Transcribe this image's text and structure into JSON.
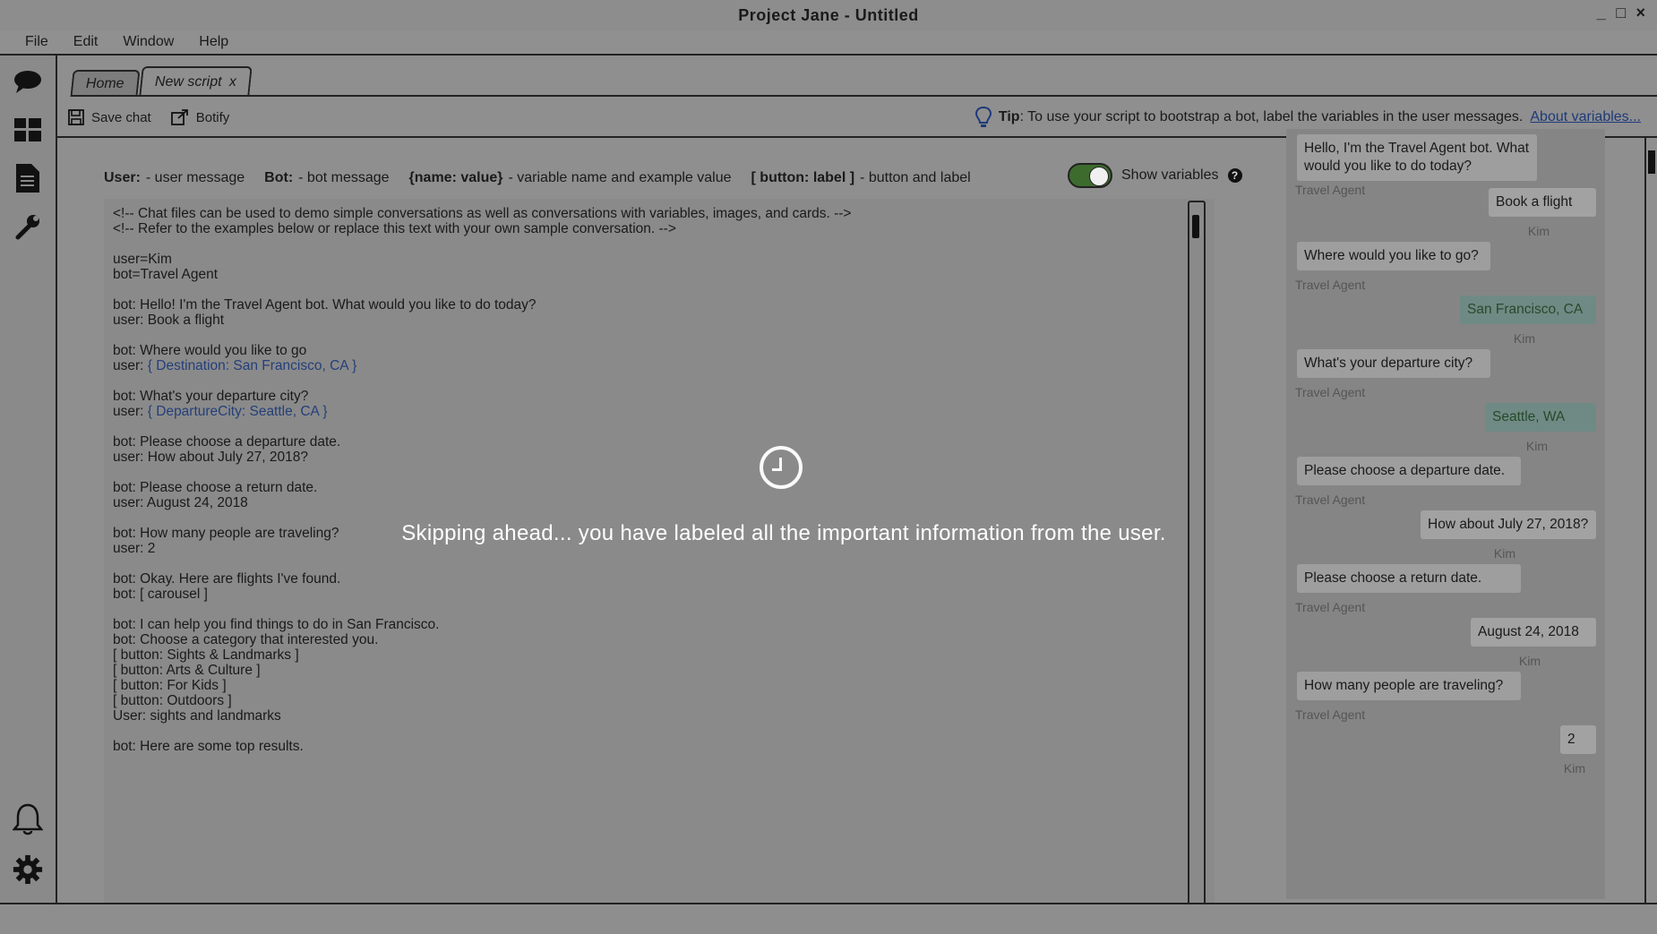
{
  "window": {
    "title": "Project Jane - Untitled",
    "controls": [
      "_",
      "□",
      "×"
    ]
  },
  "menu": [
    "File",
    "Edit",
    "Window",
    "Help"
  ],
  "tabs": [
    {
      "label": "Home"
    },
    {
      "label": "New script",
      "close": "x"
    }
  ],
  "toolbar": {
    "save_label": "Save chat",
    "botify_label": "Botify"
  },
  "tip": {
    "prefix": "Tip",
    "text": ": To use your script to bootstrap a bot, label the variables in the user messages.",
    "link": "About variables..."
  },
  "legend": {
    "user_key": "User:",
    "user_desc": "- user message",
    "bot_key": "Bot:",
    "bot_desc": "- bot message",
    "var_key": "{name: value}",
    "var_desc": "- variable name and example value",
    "btn_key": "[ button: label ]",
    "btn_desc": "- button and label"
  },
  "show_variables_label": "Show variables",
  "script": {
    "lines": [
      {
        "t": "<!-- Chat files can be used to demo simple conversations as well as conversations with variables, images, and cards. -->"
      },
      {
        "t": "<!-- Refer to the examples below or replace this text with your own sample conversation. -->"
      },
      {
        "t": ""
      },
      {
        "t": "user=Kim"
      },
      {
        "t": "bot=Travel Agent"
      },
      {
        "t": ""
      },
      {
        "t": "bot: Hello! I'm the Travel Agent bot. What would you like to do today?"
      },
      {
        "t": "user: Book a flight"
      },
      {
        "t": ""
      },
      {
        "t": "bot: Where would you like to go"
      },
      {
        "t": "user: ",
        "v": "{ Destination: San Francisco, CA }"
      },
      {
        "t": ""
      },
      {
        "t": "bot: What's your departure city?"
      },
      {
        "t": "user: ",
        "v": "{ DepartureCity: Seattle, CA }"
      },
      {
        "t": ""
      },
      {
        "t": "bot: Please choose a departure date."
      },
      {
        "t": "user: How about July 27, 2018?"
      },
      {
        "t": ""
      },
      {
        "t": "bot: Please choose a return date."
      },
      {
        "t": "user: August 24, 2018"
      },
      {
        "t": ""
      },
      {
        "t": "bot: How many people are traveling?"
      },
      {
        "t": "user: 2"
      },
      {
        "t": ""
      },
      {
        "t": "bot: Okay. Here are flights I've found."
      },
      {
        "t": "bot: [ carousel ]"
      },
      {
        "t": ""
      },
      {
        "t": "bot: I can help you find things to do in San Francisco."
      },
      {
        "t": "bot: Choose a category that interested you."
      },
      {
        "t": "[ button: Sights & Landmarks ]"
      },
      {
        "t": "[ button: Arts & Culture ]"
      },
      {
        "t": "[ button: For Kids ]"
      },
      {
        "t": "[ button: Outdoors ]"
      },
      {
        "t": "User: sights and landmarks"
      },
      {
        "t": ""
      },
      {
        "t": "bot: Here are some top results."
      }
    ]
  },
  "preview": {
    "messages": [
      {
        "from": "bot",
        "text": "Hello, I'm the Travel Agent bot. What would you like to do today?",
        "who": "Travel Agent"
      },
      {
        "from": "user",
        "text": "Book a flight",
        "who": "Kim"
      },
      {
        "from": "bot",
        "text": "Where would you like to go?",
        "who": "Travel Agent"
      },
      {
        "from": "user",
        "text": "San Francisco, CA",
        "who": "Kim",
        "variable": true
      },
      {
        "from": "bot",
        "text": "What's your departure city?",
        "who": "Travel Agent"
      },
      {
        "from": "user",
        "text": "Seattle, WA",
        "who": "Kim",
        "variable": true
      },
      {
        "from": "bot",
        "text": "Please choose a departure date.",
        "who": "Travel Agent"
      },
      {
        "from": "user",
        "text": "How about July 27, 2018?",
        "who": "Kim"
      },
      {
        "from": "bot",
        "text": "Please choose a return date.",
        "who": "Travel Agent"
      },
      {
        "from": "user",
        "text": "August 24, 2018",
        "who": "Kim"
      },
      {
        "from": "bot",
        "text": "How many people are traveling?",
        "who": "Travel Agent"
      },
      {
        "from": "user",
        "text": "2",
        "who": "Kim"
      }
    ]
  },
  "overlay": {
    "message": "Skipping ahead... you have labeled all the important information from the user."
  },
  "colors": {
    "overlay_text": "#ffffff",
    "toggle_on": "#3d6b2e",
    "variable_text": "#243f7a"
  }
}
